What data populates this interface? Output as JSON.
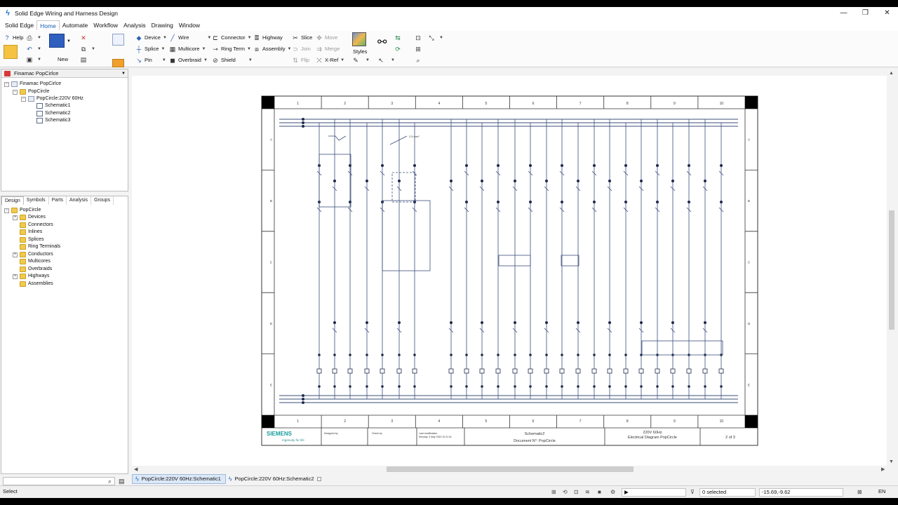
{
  "window": {
    "title": "Solid Edge Wiring and Harness Design",
    "controls": [
      "—",
      "❐",
      "✕"
    ]
  },
  "menu": [
    "Solid Edge",
    "Home",
    "Automate",
    "Workflow",
    "Analysis",
    "Drawing",
    "Window"
  ],
  "ribbon": {
    "help": "Help",
    "new": "New",
    "col1": [
      "Device",
      "Splice",
      "Pin"
    ],
    "col2": [
      "Wire",
      "Multicore",
      "Overbraid"
    ],
    "col3": [
      "Connector",
      "Ring Term",
      "Shield"
    ],
    "col4": [
      "Highway",
      "Assembly"
    ],
    "col5": [
      "Slice",
      "Join",
      "Flip"
    ],
    "col6": [
      "Move",
      "Merge",
      "X-Ref"
    ],
    "styles": "Styles"
  },
  "project_panel": {
    "selector": "Finamac PopCirlce",
    "tree": [
      {
        "label": "Finamac PopCirlce",
        "level": 0
      },
      {
        "label": "PopCircle",
        "level": 1
      },
      {
        "label": "PopCircle:220V 60Hz",
        "level": 2
      },
      {
        "label": "Schematic1",
        "level": 3
      },
      {
        "label": "Schematic2",
        "level": 3
      },
      {
        "label": "Schematic3",
        "level": 3
      }
    ]
  },
  "design_panel": {
    "tabs": [
      "Design",
      "Symbols",
      "Parts",
      "Analysis",
      "Groups"
    ],
    "root": "PopCircle",
    "items": [
      {
        "label": "Devices",
        "expandable": true
      },
      {
        "label": "Connectors",
        "expandable": false
      },
      {
        "label": "Inlines",
        "expandable": false
      },
      {
        "label": "Splices",
        "expandable": false
      },
      {
        "label": "Ring Terminals",
        "expandable": false
      },
      {
        "label": "Conductors",
        "expandable": true
      },
      {
        "label": "Multicores",
        "expandable": false
      },
      {
        "label": "Overbraids",
        "expandable": false
      },
      {
        "label": "Highways",
        "expandable": true
      },
      {
        "label": "Assemblies",
        "expandable": false
      }
    ]
  },
  "drawing": {
    "column_labels": [
      "1",
      "2",
      "3",
      "4",
      "5",
      "6",
      "7",
      "8",
      "9",
      "10"
    ],
    "row_labels": [
      "A",
      "B",
      "C",
      "D",
      "E"
    ],
    "title_block": {
      "company": "SIEMENS",
      "tagline": "Ingenuity for life",
      "designed_by": "Designed by",
      "checked_by": "Check by",
      "last_modified": "Last modification",
      "last_modified_date": "Monday, 4 May 2020 10:11:31",
      "schematic": "Schematic2",
      "document": "Document N°: PopCircle",
      "spec_line1": "220V 60Hz",
      "spec_line2": "Electrical Diagram PopCircle",
      "page": "2 of 3"
    },
    "annotation": "2.5 mm²"
  },
  "doc_tabs": [
    {
      "label": "PopCircle:220V 60Hz:Schematic1",
      "active": true
    },
    {
      "label": "PopCircle:220V 60Hz:Schematic2",
      "active": false
    }
  ],
  "status": {
    "prompt": "Select",
    "selection": "0 selected",
    "coords": "-15.69,-9.62",
    "language": "EN"
  }
}
